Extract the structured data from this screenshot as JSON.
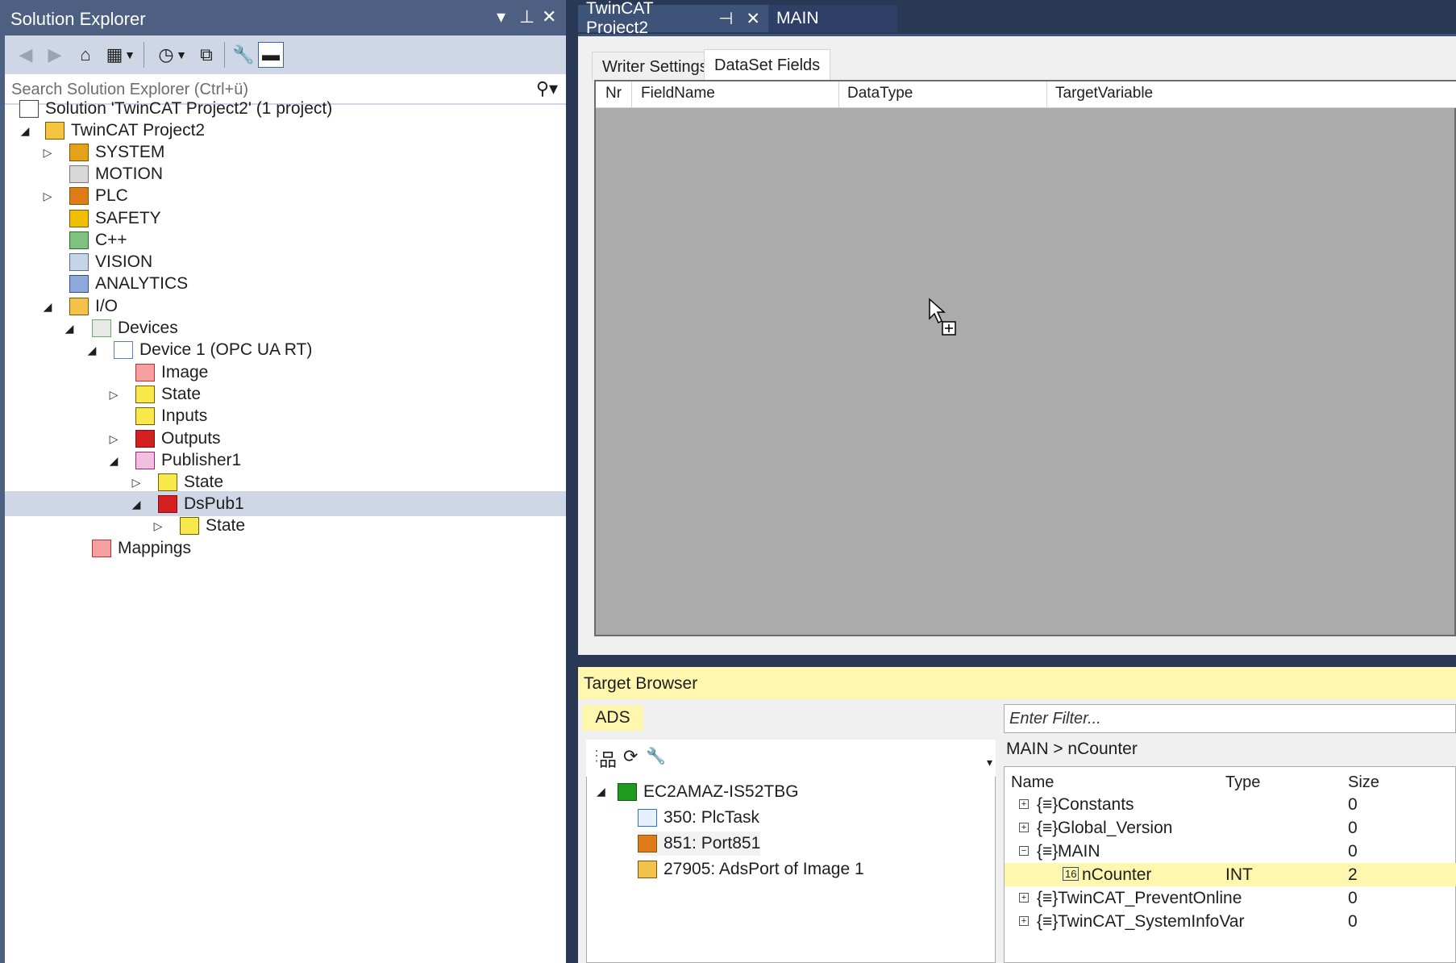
{
  "solution_explorer": {
    "title": "Solution Explorer",
    "controls": [
      "▾",
      "⊥",
      "✕"
    ],
    "search_placeholder": "Search Solution Explorer (Ctrl+ü)",
    "tree": [
      {
        "label": "Solution 'TwinCAT Project2' (1 project)",
        "icon": "solution-icon",
        "color": "#c0504d"
      },
      {
        "label": "TwinCAT Project2",
        "icon": "twincat-project-icon",
        "color": "#f5c542"
      },
      {
        "label": "SYSTEM",
        "icon": "system-icon",
        "color": "#e3a21a"
      },
      {
        "label": "MOTION",
        "icon": "motion-icon",
        "color": "#9a9a9a"
      },
      {
        "label": "PLC",
        "icon": "plc-icon",
        "color": "#e07b1a"
      },
      {
        "label": "SAFETY",
        "icon": "safety-icon",
        "color": "#f0c000"
      },
      {
        "label": "C++",
        "icon": "cpp-icon",
        "color": "#3a8f3a"
      },
      {
        "label": "VISION",
        "icon": "vision-icon",
        "color": "#8aa4c8"
      },
      {
        "label": "ANALYTICS",
        "icon": "analytics-icon",
        "color": "#4a6fb5"
      },
      {
        "label": "I/O",
        "icon": "io-icon",
        "color": "#e3a21a"
      },
      {
        "label": "Devices",
        "icon": "devices-icon",
        "color": "#6aaa6a"
      },
      {
        "label": "Device 1 (OPC UA RT)",
        "icon": "opc-device-icon",
        "color": "#5a7bd0"
      },
      {
        "label": "Image",
        "icon": "image-icon",
        "color": "#e04040"
      },
      {
        "label": "State",
        "icon": "state-icon",
        "color": "#f7e94a"
      },
      {
        "label": "Inputs",
        "icon": "inputs-icon",
        "color": "#f7e94a"
      },
      {
        "label": "Outputs",
        "icon": "outputs-icon",
        "color": "#d42020"
      },
      {
        "label": "Publisher1",
        "icon": "publisher-icon",
        "color": "#c040a0"
      },
      {
        "label": "State",
        "icon": "state-icon",
        "color": "#f7e94a"
      },
      {
        "label": "DsPub1",
        "icon": "dataset-publisher-icon",
        "color": "#d42020"
      },
      {
        "label": "State",
        "icon": "state-icon",
        "color": "#f7e94a"
      },
      {
        "label": "Mappings",
        "icon": "mappings-icon",
        "color": "#e04040"
      }
    ]
  },
  "doc_tabs": {
    "active": "TwinCAT Project2",
    "active_pin": "⊣",
    "active_close": "✕",
    "other": "MAIN"
  },
  "editor": {
    "tabs": [
      "Writer Settings",
      "DataSet Fields"
    ],
    "columns": [
      "Nr",
      "FieldName",
      "DataType",
      "TargetVariable"
    ]
  },
  "target_browser": {
    "title": "Target Browser",
    "left_tab": "ADS",
    "tree": [
      {
        "label": "EC2AMAZ-IS52TBG",
        "icon": "computer-icon"
      },
      {
        "label": "350: PlcTask",
        "icon": "task-icon"
      },
      {
        "label": "851: Port851",
        "icon": "plc-port-icon"
      },
      {
        "label": "27905: AdsPort of Image 1",
        "icon": "ads-port-icon"
      }
    ],
    "filter_placeholder": "Enter Filter...",
    "breadcrumb": "MAIN > nCounter",
    "columns": [
      "Name",
      "Type",
      "Size"
    ],
    "rows": [
      {
        "name": "Constants",
        "type": "",
        "size": "0",
        "sign": "+"
      },
      {
        "name": "Global_Version",
        "type": "",
        "size": "0",
        "sign": "+"
      },
      {
        "name": "MAIN",
        "type": "",
        "size": "0",
        "sign": "−"
      },
      {
        "name": "nCounter",
        "type": "INT",
        "size": "2",
        "sign": ""
      },
      {
        "name": "TwinCAT_PreventOnline",
        "type": "",
        "size": "0",
        "sign": "+"
      },
      {
        "name": "TwinCAT_SystemInfoVar",
        "type": "",
        "size": "0",
        "sign": "+"
      }
    ],
    "var_icon_text": "16",
    "ns_icon_text": "{≡}"
  }
}
